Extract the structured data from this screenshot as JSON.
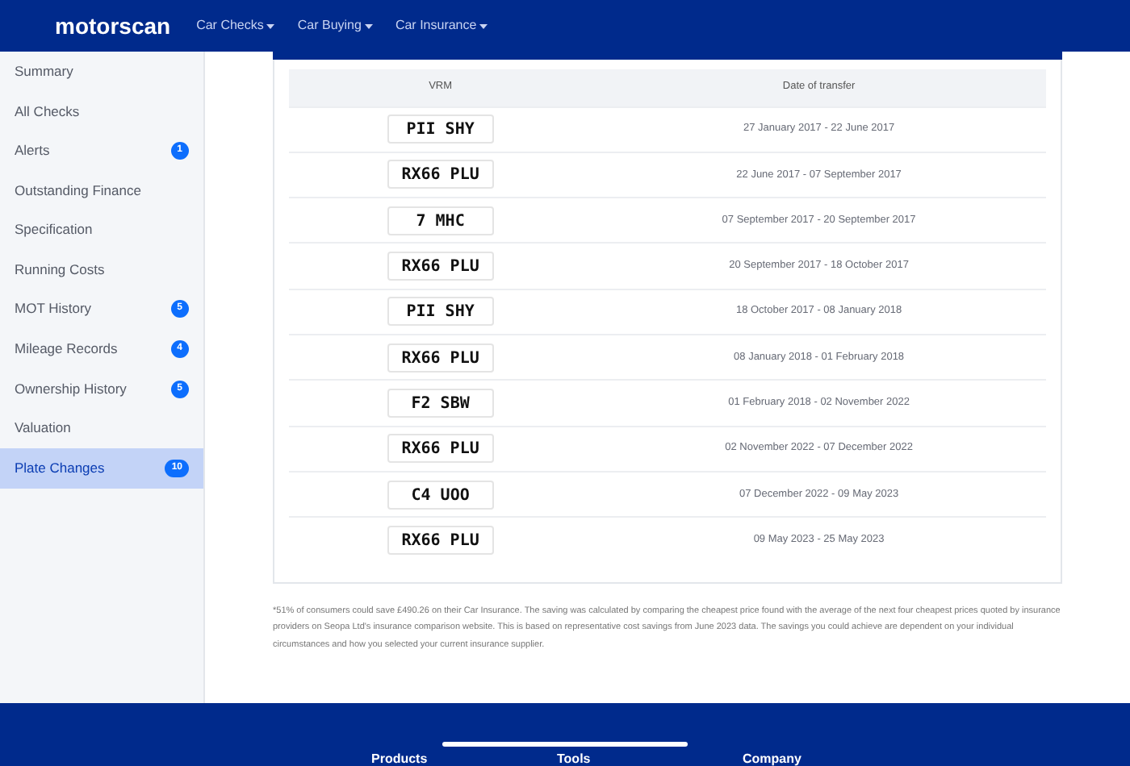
{
  "navbar": {
    "brand": "motorscan",
    "menus": [
      {
        "label": "Car Checks"
      },
      {
        "label": "Car Buying"
      },
      {
        "label": "Car Insurance"
      }
    ]
  },
  "sidebar": {
    "items": [
      {
        "label": "Summary",
        "selected": false
      },
      {
        "label": "All Checks",
        "selected": false
      },
      {
        "label": "Alerts",
        "badge": "1",
        "selected": false
      },
      {
        "label": "Outstanding Finance",
        "selected": false
      },
      {
        "label": "Specification",
        "selected": false
      },
      {
        "label": "Running Costs",
        "selected": false
      },
      {
        "label": "MOT History",
        "badge": "5",
        "selected": false
      },
      {
        "label": "Mileage Records",
        "badge": "4",
        "selected": false
      },
      {
        "label": "Ownership History",
        "badge": "5",
        "selected": false
      },
      {
        "label": "Valuation",
        "selected": false
      },
      {
        "label": "Plate Changes",
        "badge": "10",
        "selected": true
      }
    ]
  },
  "table": {
    "columns": [
      "VRM",
      "Date of transfer"
    ],
    "rows": [
      {
        "vrm": "PII SHY",
        "date": "27 January 2017 - 22 June 2017"
      },
      {
        "vrm": "RX66 PLU",
        "date": "22 June 2017 - 07 September 2017"
      },
      {
        "vrm": "7 MHC",
        "date": "07 September 2017 - 20 September 2017"
      },
      {
        "vrm": "RX66 PLU",
        "date": "20 September 2017 - 18 October 2017"
      },
      {
        "vrm": "PII SHY",
        "date": "18 October 2017 - 08 January 2018"
      },
      {
        "vrm": "RX66 PLU",
        "date": "08 January 2018 - 01 February 2018"
      },
      {
        "vrm": "F2 SBW",
        "date": "01 February 2018 - 02 November 2022"
      },
      {
        "vrm": "RX66 PLU",
        "date": "02 November 2022 - 07 December 2022"
      },
      {
        "vrm": "C4 UOO",
        "date": "07 December 2022 - 09 May 2023"
      },
      {
        "vrm": "RX66 PLU",
        "date": "09 May 2023 - 25 May 2023"
      }
    ]
  },
  "disclaimer": "*51% of consumers could save £490.26 on their Car Insurance. The saving was calculated by comparing the cheapest price found with the average of the next four cheapest prices quoted by insurance providers on Seopa Ltd's insurance comparison website. This is based on representative cost savings from June 2023 data. The savings you could achieve are dependent on your individual circumstances and how you selected your current insurance supplier.",
  "footer": {
    "headings": [
      "Products",
      "Tools",
      "Company"
    ]
  }
}
